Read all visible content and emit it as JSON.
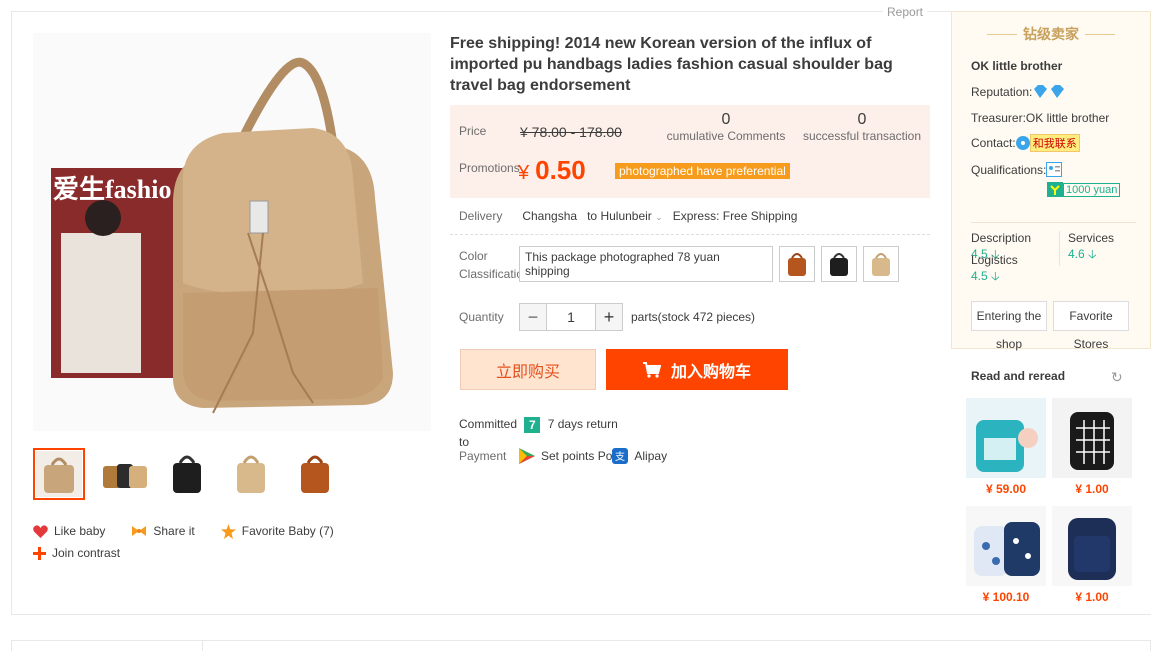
{
  "report_label": "Report",
  "product": {
    "title": "Free shipping! 2014 new Korean version of the influx of imported pu handbags ladies fashion casual shoulder bag travel bag endorsement",
    "price_label": "Price",
    "original_price": "¥ 78.00 - 178.00",
    "promo_label": "Promotions",
    "promo_currency": "¥",
    "promo_price": "0.50",
    "promo_tag": "photographed have preferential",
    "comments_count": "0",
    "comments_label": "cumulative Comments",
    "transactions_count": "0",
    "transactions_label": "successful transaction",
    "delivery_label": "Delivery",
    "delivery_from": "Changsha",
    "delivery_to_word": "to",
    "delivery_to": "Hulunbeir",
    "delivery_shipping": "Express: Free Shipping",
    "color_label_1": "Color",
    "color_label_2": "Classificatio",
    "sku_text": "This package photographed 78 yuan shipping",
    "qty_label": "Quantity",
    "qty_value": "1",
    "qty_minus": "−",
    "qty_plus": "+",
    "stock_text": "parts(stock 472 pieces)",
    "buy_now": "立即购买",
    "add_cart": "加入购物车",
    "committed_label": "Committed",
    "seven_badge": "7",
    "return_text": "7 days return",
    "to_label": "to",
    "payment_label": "Payment",
    "pay_method_1": "Set points Po",
    "pay_method_2": "Alipay"
  },
  "actions": {
    "like": "Like baby",
    "share": "Share it",
    "favorite": "Favorite Baby (7)",
    "compare": "Join contrast"
  },
  "seller": {
    "level_title": "钻级卖家",
    "name": "OK little brother",
    "reputation_label": "Reputation:",
    "treasurer_label": "Treasurer:",
    "treasurer_value": "OK little brother",
    "contact_label": "Contact:",
    "contact_tag": "和我联系",
    "qualifications_label": "Qualifications:",
    "yuan_tag": "1000 yuan",
    "description_label": "Description",
    "description_score": "4.5",
    "services_label": "Services",
    "services_score": "4.6",
    "logistics_label": "Logistics",
    "logistics_score": "4.5",
    "btn_enter_1": "Entering the",
    "btn_enter_2": "shop",
    "btn_fav_1": "Favorite",
    "btn_fav_2": "Stores"
  },
  "reread": {
    "title": "Read and reread",
    "items": [
      {
        "price": "¥ 59.00"
      },
      {
        "price": "¥ 1.00"
      },
      {
        "price": "¥ 100.10"
      },
      {
        "price": "¥ 1.00"
      }
    ]
  },
  "colors": {
    "accent": "#ff4400",
    "price_bg": "#fdf0ea",
    "score_green": "#1fb08f",
    "seller_gold": "#c8a15d"
  }
}
